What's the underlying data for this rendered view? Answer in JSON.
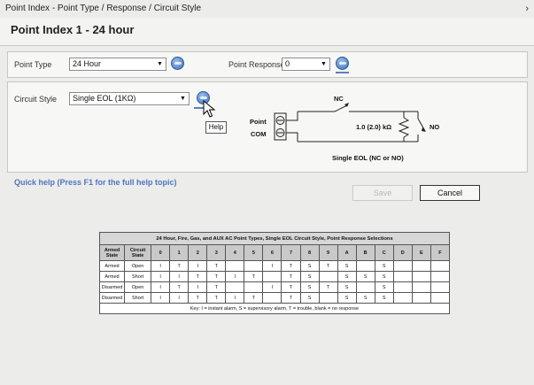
{
  "window": {
    "title": "Point Index - Point Type / Response / Circuit Style",
    "close": "›"
  },
  "header": {
    "title": "Point Index 1 - 24 hour"
  },
  "point_type": {
    "label": "Point Type",
    "value": "24 Hour"
  },
  "point_response": {
    "label": "Point Response",
    "value": "0"
  },
  "circuit_style": {
    "label": "Circuit Style",
    "value": "Single EOL (1KΩ)"
  },
  "tooltip": {
    "text": "Help"
  },
  "diagram": {
    "nc": "NC",
    "no": "NO",
    "point": "Point",
    "com": "COM",
    "resistor": "1.0 (2.0) kΩ",
    "caption": "Single EOL (NC or NO)"
  },
  "quick_help": "Quick help (Press F1 for the full help topic)",
  "buttons": {
    "save": "Save",
    "cancel": "Cancel"
  },
  "table": {
    "title": "24 Hour, Fire, Gas, and AUX AC Point Types, Single EOL Circuit Style, Point Response Selections",
    "headers": [
      "Armed State",
      "Circuit State",
      "0",
      "1",
      "2",
      "3",
      "4",
      "5",
      "6",
      "7",
      "8",
      "9",
      "A",
      "B",
      "C",
      "D",
      "E",
      "F"
    ],
    "rows": [
      [
        "Armed",
        "Open",
        "I",
        "T",
        "I",
        "T",
        "",
        "",
        "I",
        "T",
        "S",
        "T",
        "S",
        "",
        "S",
        "",
        "",
        ""
      ],
      [
        "Armed",
        "Short",
        "I",
        "I",
        "T",
        "T",
        "I",
        "T",
        "",
        "T",
        "S",
        "",
        "S",
        "S",
        "S",
        "",
        "",
        ""
      ],
      [
        "Disarmed",
        "Open",
        "I",
        "T",
        "I",
        "T",
        "",
        "",
        "I",
        "T",
        "S",
        "T",
        "S",
        "",
        "S",
        "",
        "",
        ""
      ],
      [
        "Disarmed",
        "Short",
        "I",
        "I",
        "T",
        "T",
        "I",
        "T",
        "",
        "T",
        "S",
        "",
        "S",
        "S",
        "S",
        "",
        "",
        ""
      ]
    ],
    "key": "Key: I = instant alarm, S = supervisory alarm, T = trouble, blank = no response"
  }
}
